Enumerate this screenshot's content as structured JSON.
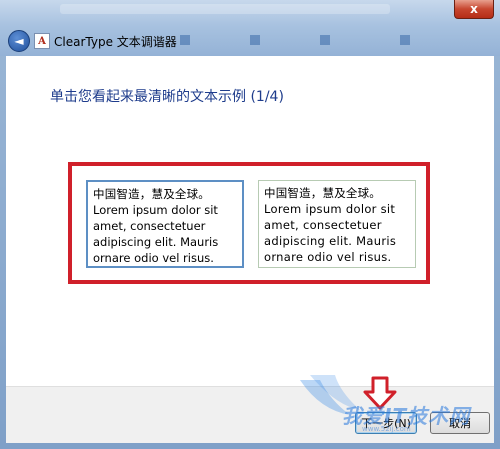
{
  "window": {
    "title": "ClearType 文本调谐器",
    "close_label": "x",
    "app_icon_glyph": "A",
    "back_glyph": "◄"
  },
  "content": {
    "heading": "单击您看起来最清晰的文本示例 (1/4)",
    "samples": [
      {
        "zh": "中国智造，慧及全球。",
        "en": "Lorem ipsum dolor sit amet, consectetuer adipiscing elit. Mauris ornare odio vel risus.",
        "selected": true
      },
      {
        "zh": "中国智造，慧及全球。",
        "en": "Lorem ipsum dolor sit amet, consectetuer adipiscing elit. Mauris ornare odio vel risus.",
        "selected": false
      }
    ]
  },
  "buttons": {
    "next": "下一步(N)",
    "cancel": "取消"
  },
  "watermark": {
    "text": "我爱IT技术网",
    "sub": "www.52ij.com"
  },
  "colors": {
    "highlight_frame": "#d0202a",
    "selected_border": "#5d8fc4",
    "heading": "#1e3c8c",
    "arrow": "#d0202a"
  },
  "icons": {
    "back": "back-arrow-icon",
    "app": "cleartype-app-icon",
    "annotation": "down-arrow-annotation-icon"
  }
}
